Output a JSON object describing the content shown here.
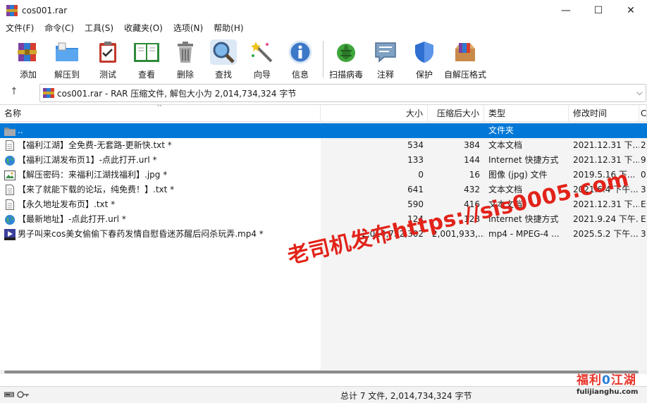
{
  "window": {
    "title": "cos001.rar",
    "minimize": "—",
    "maximize": "☐",
    "close": "✕"
  },
  "menu": [
    {
      "label": "文件(F)"
    },
    {
      "label": "命令(C)"
    },
    {
      "label": "工具(S)"
    },
    {
      "label": "收藏夹(O)"
    },
    {
      "label": "选项(N)"
    },
    {
      "label": "帮助(H)"
    }
  ],
  "toolbar": [
    {
      "label": "添加",
      "icon": "books-add-icon"
    },
    {
      "label": "解压到",
      "icon": "folder-extract-icon"
    },
    {
      "label": "测试",
      "icon": "clipboard-check-icon"
    },
    {
      "label": "查看",
      "icon": "open-book-icon"
    },
    {
      "label": "删除",
      "icon": "trash-icon"
    },
    {
      "label": "查找",
      "icon": "magnifier-icon"
    },
    {
      "label": "向导",
      "icon": "wand-icon"
    },
    {
      "label": "信息",
      "icon": "info-icon"
    },
    {
      "label": "扫描病毒",
      "icon": "bug-scan-icon"
    },
    {
      "label": "注释",
      "icon": "comment-icon"
    },
    {
      "label": "保护",
      "icon": "shield-icon"
    },
    {
      "label": "自解压格式",
      "icon": "sfx-box-icon"
    }
  ],
  "address": {
    "up_icon": "↑",
    "path": "cos001.rar - RAR 压缩文件, 解包大小为 2,014,734,324 字节",
    "dropdown_icon": "⌵"
  },
  "columns": {
    "name": "名称",
    "size": "大小",
    "packed": "压缩后大小",
    "type": "类型",
    "modified": "修改时间",
    "extra": "C"
  },
  "files": [
    {
      "name": "..",
      "size": "",
      "packed": "",
      "type": "文件夹",
      "modified": "",
      "extra": "",
      "icon": "folder",
      "selected": true
    },
    {
      "name": "【福利江湖】全免费-无套路-更新快.txt *",
      "size": "534",
      "packed": "384",
      "type": "文本文档",
      "modified": "2021.12.31 下...",
      "extra": "2",
      "icon": "text"
    },
    {
      "name": "【福利江湖发布页1】-点此打开.url *",
      "size": "133",
      "packed": "144",
      "type": "Internet 快捷方式",
      "modified": "2021.12.31 下...",
      "extra": "9",
      "icon": "globe"
    },
    {
      "name": "【解压密码：来福利江湖找福利】.jpg *",
      "size": "0",
      "packed": "16",
      "type": "图像 (jpg) 文件",
      "modified": "2019.5.16 下...",
      "extra": "0",
      "icon": "image"
    },
    {
      "name": "【来了就能下载的论坛，纯免费！】.txt *",
      "size": "641",
      "packed": "432",
      "type": "文本文档",
      "modified": "2021.6.4 下午...",
      "extra": "3",
      "icon": "text"
    },
    {
      "name": "【永久地址发布页】.txt *",
      "size": "590",
      "packed": "416",
      "type": "文本文档",
      "modified": "2021.12.31 下...",
      "extra": "E",
      "icon": "text"
    },
    {
      "name": "【最新地址】-点此打开.url *",
      "size": "124",
      "packed": "128",
      "type": "Internet 快捷方式",
      "modified": "2021.9.24 下午...",
      "extra": "E",
      "icon": "globe"
    },
    {
      "name": "男子叫来cos美女偷偷下春药发情自慰昏迷苏醒后闷杀玩弄.mp4 *",
      "size": "2,014,732,302",
      "packed": "2,001,933,...",
      "type": "mp4 - MPEG-4 ...",
      "modified": "2025.5.2 下午...",
      "extra": "3",
      "icon": "video"
    }
  ],
  "status": {
    "summary": "总计 7 文件, 2,014,734,324 字节"
  },
  "watermark": {
    "text": "老司机发布https://sis0005.com"
  },
  "logo": {
    "top_a": "福利",
    "top_b": "0",
    "top_c": "江湖",
    "bottom": "fulijianghu.com"
  }
}
